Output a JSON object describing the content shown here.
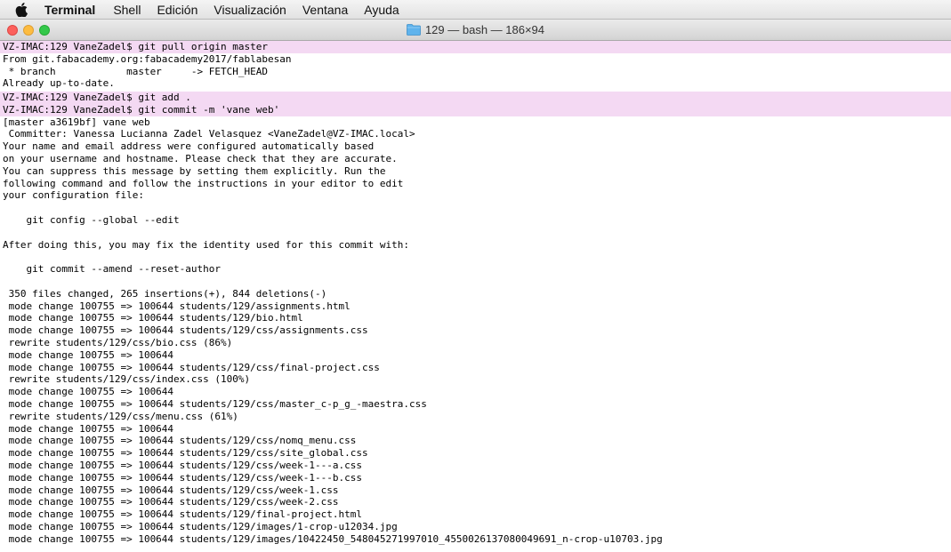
{
  "menubar": {
    "app_name": "Terminal",
    "items": [
      "Shell",
      "Edición",
      "Visualización",
      "Ventana",
      "Ayuda"
    ]
  },
  "window": {
    "title": "129 — bash — 186×94"
  },
  "colors": {
    "prompt_highlight": "#f4d9f3",
    "close": "#fc605c",
    "minimize": "#fdbc40",
    "zoom": "#34c84a",
    "folder": "#5fb3ec"
  },
  "icons": {
    "apple": "apple-logo-icon",
    "folder": "folder-icon"
  },
  "terminal": {
    "lines": [
      {
        "text": "VZ-IMAC:129 VaneZadel$ git pull origin master",
        "prompt": true
      },
      {
        "text": "From git.fabacademy.org:fabacademy2017/fablabesan",
        "prompt": false
      },
      {
        "text": " * branch            master     -> FETCH_HEAD",
        "prompt": false
      },
      {
        "text": "Already up-to-date.",
        "prompt": false
      },
      {
        "text": "VZ-IMAC:129 VaneZadel$ git add .",
        "prompt": true
      },
      {
        "text": "VZ-IMAC:129 VaneZadel$ git commit -m 'vane web'",
        "prompt": true
      },
      {
        "text": "[master a3619bf] vane web",
        "prompt": false
      },
      {
        "text": " Committer: Vanessa Lucianna Zadel Velasquez <VaneZadel@VZ-IMAC.local>",
        "prompt": false
      },
      {
        "text": "Your name and email address were configured automatically based",
        "prompt": false
      },
      {
        "text": "on your username and hostname. Please check that they are accurate.",
        "prompt": false
      },
      {
        "text": "You can suppress this message by setting them explicitly. Run the",
        "prompt": false
      },
      {
        "text": "following command and follow the instructions in your editor to edit",
        "prompt": false
      },
      {
        "text": "your configuration file:",
        "prompt": false
      },
      {
        "text": "",
        "prompt": false
      },
      {
        "text": "    git config --global --edit",
        "prompt": false
      },
      {
        "text": "",
        "prompt": false
      },
      {
        "text": "After doing this, you may fix the identity used for this commit with:",
        "prompt": false
      },
      {
        "text": "",
        "prompt": false
      },
      {
        "text": "    git commit --amend --reset-author",
        "prompt": false
      },
      {
        "text": "",
        "prompt": false
      },
      {
        "text": " 350 files changed, 265 insertions(+), 844 deletions(-)",
        "prompt": false
      },
      {
        "text": " mode change 100755 => 100644 students/129/assignments.html",
        "prompt": false
      },
      {
        "text": " mode change 100755 => 100644 students/129/bio.html",
        "prompt": false
      },
      {
        "text": " mode change 100755 => 100644 students/129/css/assignments.css",
        "prompt": false
      },
      {
        "text": " rewrite students/129/css/bio.css (86%)",
        "prompt": false
      },
      {
        "text": " mode change 100755 => 100644",
        "prompt": false
      },
      {
        "text": " mode change 100755 => 100644 students/129/css/final-project.css",
        "prompt": false
      },
      {
        "text": " rewrite students/129/css/index.css (100%)",
        "prompt": false
      },
      {
        "text": " mode change 100755 => 100644",
        "prompt": false
      },
      {
        "text": " mode change 100755 => 100644 students/129/css/master_c-p_g_-maestra.css",
        "prompt": false
      },
      {
        "text": " rewrite students/129/css/menu.css (61%)",
        "prompt": false
      },
      {
        "text": " mode change 100755 => 100644",
        "prompt": false
      },
      {
        "text": " mode change 100755 => 100644 students/129/css/nomq_menu.css",
        "prompt": false
      },
      {
        "text": " mode change 100755 => 100644 students/129/css/site_global.css",
        "prompt": false
      },
      {
        "text": " mode change 100755 => 100644 students/129/css/week-1---a.css",
        "prompt": false
      },
      {
        "text": " mode change 100755 => 100644 students/129/css/week-1---b.css",
        "prompt": false
      },
      {
        "text": " mode change 100755 => 100644 students/129/css/week-1.css",
        "prompt": false
      },
      {
        "text": " mode change 100755 => 100644 students/129/css/week-2.css",
        "prompt": false
      },
      {
        "text": " mode change 100755 => 100644 students/129/final-project.html",
        "prompt": false
      },
      {
        "text": " mode change 100755 => 100644 students/129/images/1-crop-u12034.jpg",
        "prompt": false
      },
      {
        "text": " mode change 100755 => 100644 students/129/images/10422450_548045271997010_4550026137080049691_n-crop-u10703.jpg",
        "prompt": false
      }
    ]
  }
}
